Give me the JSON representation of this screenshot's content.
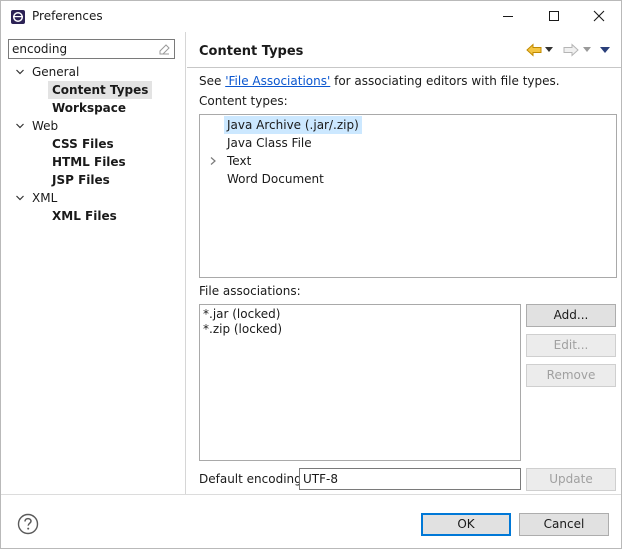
{
  "window": {
    "title": "Preferences",
    "icon": "eclipse-icon"
  },
  "filter": {
    "value": "encoding"
  },
  "tree": {
    "items": [
      {
        "label": "General",
        "expanded": true,
        "bold": false
      },
      {
        "label": "Content Types",
        "bold": true,
        "selected": true
      },
      {
        "label": "Workspace",
        "bold": true
      },
      {
        "label": "Web",
        "expanded": true,
        "bold": false
      },
      {
        "label": "CSS Files",
        "bold": true
      },
      {
        "label": "HTML Files",
        "bold": true
      },
      {
        "label": "JSP Files",
        "bold": true
      },
      {
        "label": "XML",
        "expanded": true,
        "bold": false
      },
      {
        "label": "XML Files",
        "bold": true
      }
    ]
  },
  "page": {
    "title": "Content Types",
    "see_prefix": "See ",
    "see_link": "'File Associations'",
    "see_suffix": " for associating editors with file types.",
    "content_types_label": "Content types:",
    "content_types": [
      {
        "label": "Java Archive (.jar/.zip)",
        "selected": true,
        "has_children": false
      },
      {
        "label": "Java Class File",
        "has_children": false
      },
      {
        "label": "Text",
        "has_children": true
      },
      {
        "label": "Word Document",
        "has_children": false
      }
    ],
    "file_assoc_label": "File associations:",
    "file_associations": [
      "*.jar (locked)",
      "*.zip (locked)"
    ],
    "buttons": {
      "add": "Add...",
      "edit": "Edit...",
      "remove": "Remove",
      "update": "Update"
    },
    "default_encoding_label": "Default encoding:",
    "default_encoding_value": "UTF-8"
  },
  "footer": {
    "ok": "OK",
    "cancel": "Cancel"
  },
  "colors": {
    "accent": "#0078d7",
    "selection": "#cce8ff",
    "nav_arrow": "#e8a400"
  }
}
